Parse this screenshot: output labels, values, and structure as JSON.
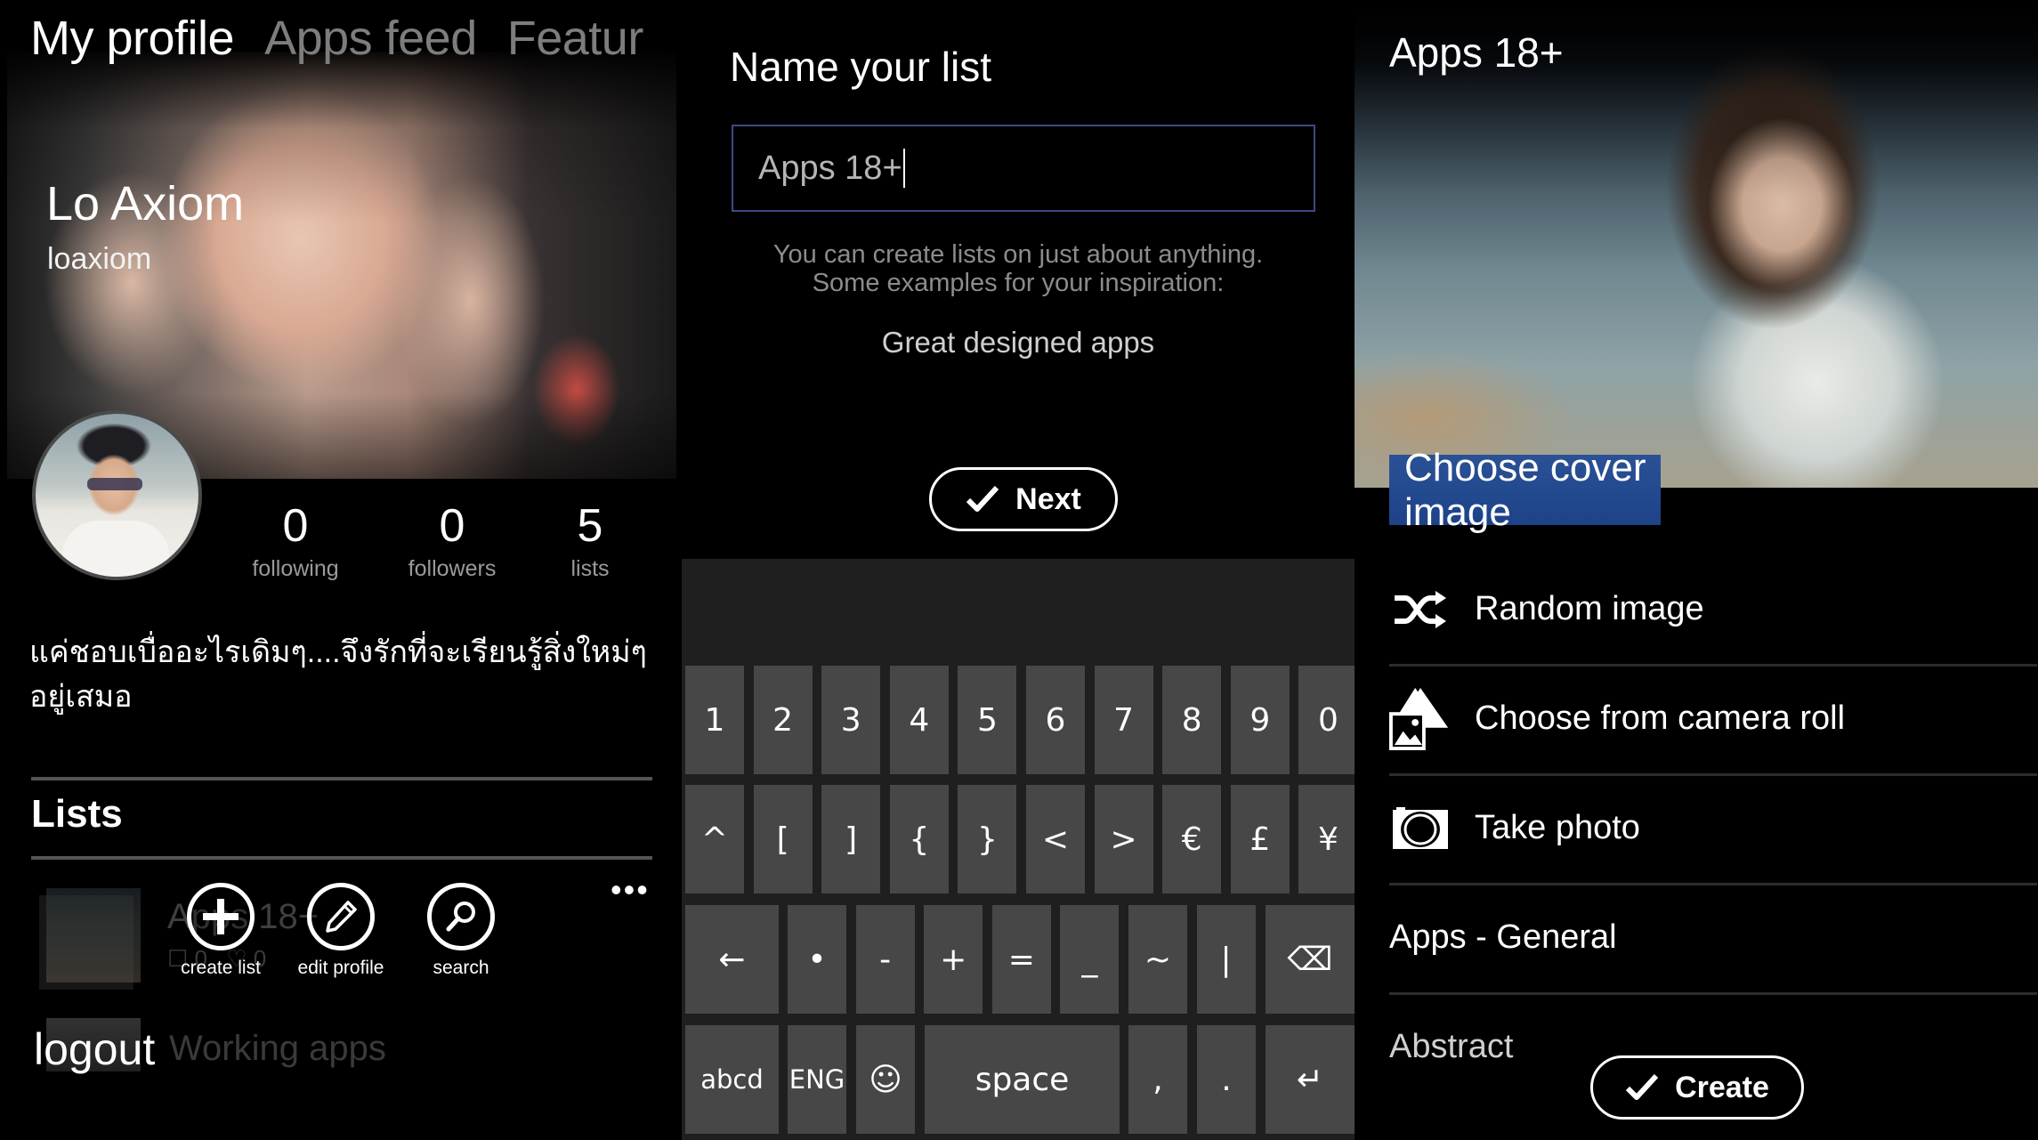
{
  "profile_screen": {
    "tabs": [
      {
        "label": "My profile",
        "active": true
      },
      {
        "label": "Apps feed",
        "active": false
      },
      {
        "label": "Featur",
        "active": false
      }
    ],
    "name": "Lo Axiom",
    "handle": "loaxiom",
    "stats": [
      {
        "value": "0",
        "label": "following"
      },
      {
        "value": "0",
        "label": "followers"
      },
      {
        "value": "5",
        "label": "lists"
      }
    ],
    "bio": "แค่ชอบเบื่ออะไรเดิมๆ....จึงรักที่จะเรียนรู้สิ่งใหม่ๆ อยู่เสมอ",
    "lists_heading": "Lists",
    "lists": [
      {
        "title": "Apps 18+",
        "items_count": "0",
        "likes_count": "0"
      },
      {
        "title": "Working apps"
      }
    ],
    "app_bar": {
      "buttons": [
        {
          "label": "create list",
          "icon": "plus-icon"
        },
        {
          "label": "edit profile",
          "icon": "pencil-icon"
        },
        {
          "label": "search",
          "icon": "search-icon"
        }
      ],
      "more": "•••",
      "menu_items": [
        "logout"
      ]
    }
  },
  "name_list_screen": {
    "title": "Name your list",
    "input_value": "Apps 18+",
    "help_line1": "You can create lists on just about anything.",
    "help_line2": "Some examples for your inspiration:",
    "example": "Great designed apps",
    "next_label": "Next",
    "keyboard": {
      "row1": [
        "1",
        "2",
        "3",
        "4",
        "5",
        "6",
        "7",
        "8",
        "9",
        "0"
      ],
      "row2": [
        "^",
        "[",
        "]",
        "{",
        "}",
        "<",
        ">",
        "€",
        "£",
        "¥"
      ],
      "row3": [
        "←",
        "•",
        "-",
        "+",
        "=",
        "_",
        "~",
        "|",
        "⌫"
      ],
      "row4": [
        "abcd",
        "ENG",
        "☺",
        "space",
        ",",
        ".",
        "↵"
      ]
    }
  },
  "cover_screen": {
    "title": "Apps 18+",
    "choose_cover_label": "Choose cover image",
    "options": [
      {
        "label": "Random image",
        "icon": "shuffle-icon"
      },
      {
        "label": "Choose from camera roll",
        "icon": "camera-roll-icon"
      },
      {
        "label": "Take photo",
        "icon": "camera-icon"
      },
      {
        "label": "Apps - General"
      },
      {
        "label": "Abstract"
      }
    ],
    "create_label": "Create",
    "accent_color": "#1d4288"
  }
}
